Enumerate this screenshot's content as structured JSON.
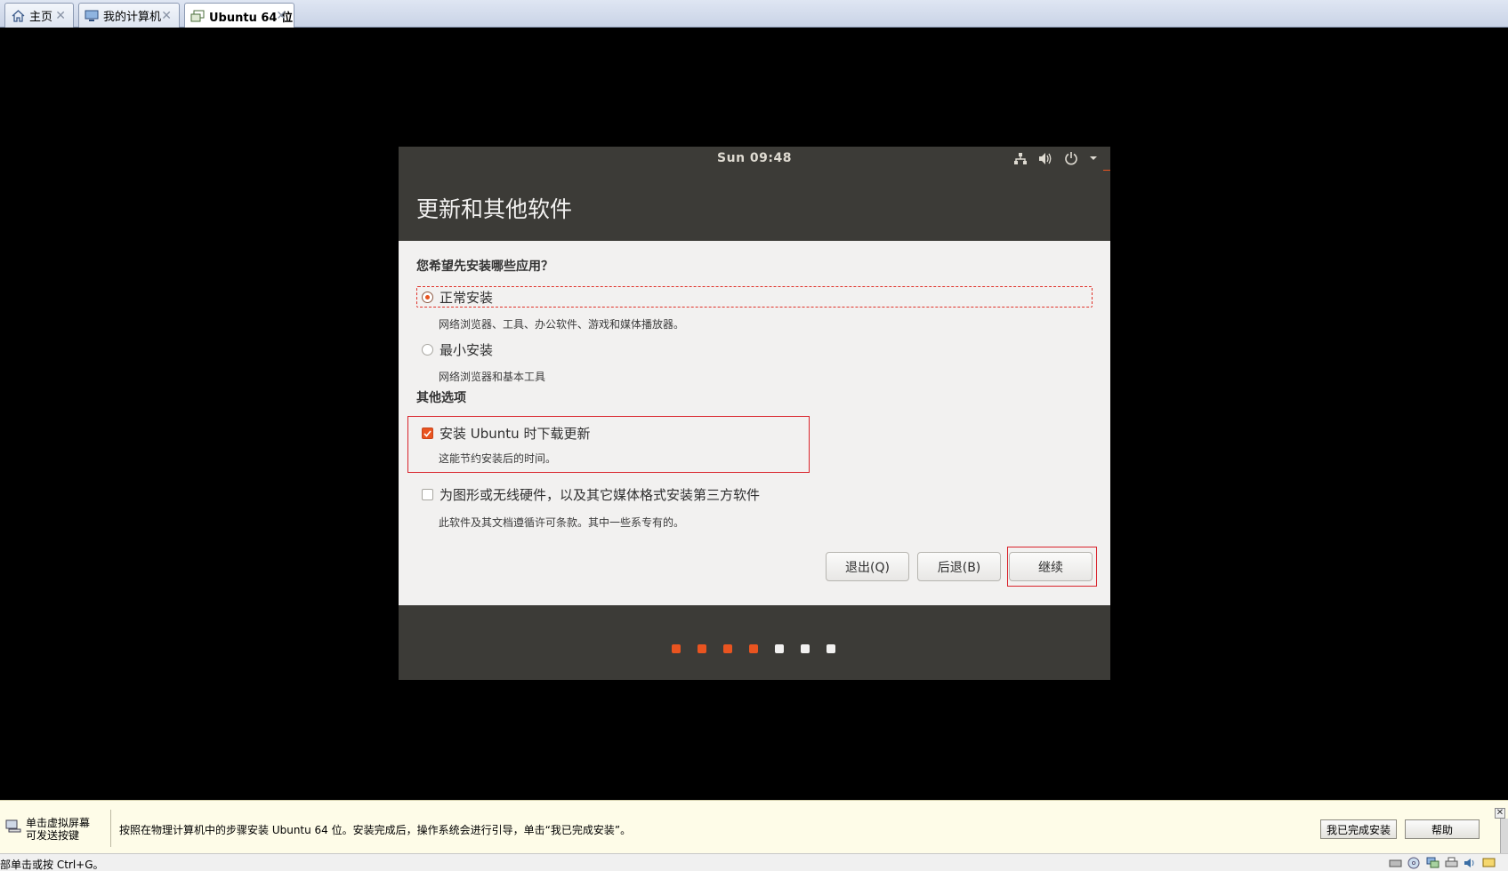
{
  "tabs": [
    {
      "label": "主页",
      "icon": "home-icon"
    },
    {
      "label": "我的计算机",
      "icon": "computer-icon"
    },
    {
      "label": "Ubuntu 64 位",
      "icon": "vm-icon",
      "active": true
    }
  ],
  "installer": {
    "clock": "Sun 09:48",
    "tray_icons": [
      "network-icon",
      "volume-icon",
      "power-icon",
      "chevron-down-icon"
    ],
    "title": "更新和其他软件",
    "question": "您希望先安装哪些应用？",
    "options": [
      {
        "label": "正常安装",
        "description": "网络浏览器、工具、办公软件、游戏和媒体播放器。",
        "selected": true
      },
      {
        "label": "最小安装",
        "description": "网络浏览器和基本工具",
        "selected": false
      }
    ],
    "other_section_label": "其他选项",
    "checkboxes": [
      {
        "label": "安装 Ubuntu 时下载更新",
        "description": "这能节约安装后的时间。",
        "checked": true
      },
      {
        "label": "为图形或无线硬件，以及其它媒体格式安装第三方软件",
        "description": "此软件及其文档遵循许可条款。其中一些系专有的。",
        "checked": false
      }
    ],
    "buttons": {
      "quit": "退出(Q)",
      "back": "后退(B)",
      "continue": "继续"
    },
    "progress": {
      "total_steps": 7,
      "completed_steps": 4,
      "active_color": "#e95420",
      "inactive_color": "#f2f1f0"
    }
  },
  "hintbar": {
    "left_text_line1": "单击虚拟屏幕",
    "left_text_line2": "可发送按键",
    "message": "按照在物理计算机中的步骤安装 Ubuntu 64 位。安装完成后，操作系统会进行引导，单击“我已完成安装”。",
    "done_button": "我已完成安装",
    "help_button": "帮助"
  },
  "statusbar": {
    "text": "部单击或按 Ctrl+G。",
    "icons": [
      "hdd-icon",
      "cdrom-icon",
      "network-adapter-icon",
      "printer-icon",
      "sound-icon",
      "message-icon"
    ]
  },
  "colors": {
    "accent": "#e95420",
    "ubuntu_dark": "#3c3b37",
    "ubuntu_light": "#f2f1f0",
    "annotation_red": "#d9232b"
  }
}
